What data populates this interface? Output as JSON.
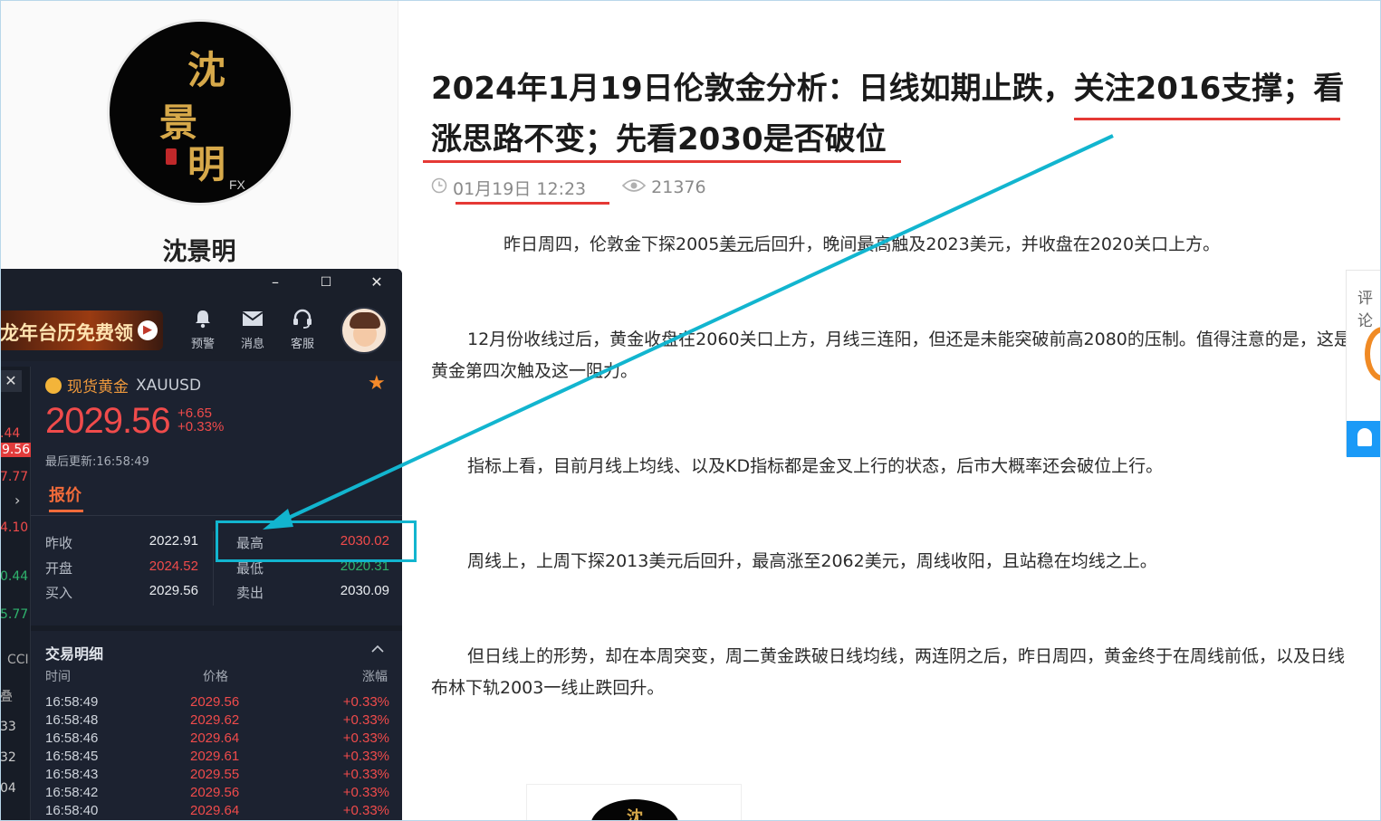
{
  "author": {
    "name": "沈景明",
    "logo_chars": [
      "沈",
      "景",
      "明"
    ],
    "logo_tag": "FX"
  },
  "article": {
    "title": "2024年1月19日伦敦金分析：日线如期止跌，关注2016支撑；看涨思路不变；先看2030是否破位",
    "date": "01月19日 12:23",
    "views": "21376",
    "paragraphs": [
      {
        "pre": "昨日周四，伦敦金下探2005",
        "link": "美元",
        "post": "后回升，晚间最高触及2023美元，并收盘在2020关口上方。"
      },
      {
        "pre": "12月份收线过后，黄金收盘在2060关口上方，月线三连阳，但还是未能突破前高2080的压制。值得注意的是，这是黄金第四次触及这一阻力。",
        "link": "",
        "post": ""
      },
      {
        "pre": "指标上看，目前月线上均线、以及KD指标都是金叉上行的状态，后市大概率还会破位上行。",
        "link": "",
        "post": ""
      },
      {
        "pre": "周线上，上周下探2013美元后回升，最高涨至2062美元，周线收阳，且站稳在均线之上。",
        "link": "",
        "post": ""
      },
      {
        "pre": "但日线上的形势，却在本周突变，周二黄金跌破日线均线，两连阴之后，昨日周四，黄金终于在周线前低，以及日线布林下轨2003一线止跌回升。",
        "link": "",
        "post": ""
      }
    ]
  },
  "side_widget": {
    "label": "评论"
  },
  "bottom_card": {
    "char": "沈"
  },
  "app": {
    "window_buttons": {
      "minimize": "–",
      "maximize": "☐",
      "close": "✕"
    },
    "banner_text": "龙年台历免费领",
    "tools": [
      {
        "icon": "bell-icon",
        "label": "预警"
      },
      {
        "icon": "mail-icon",
        "label": "消息"
      },
      {
        "icon": "headset-icon",
        "label": "客服"
      }
    ],
    "strip_values": [
      ".44",
      "9.56",
      "7.77",
      "4.10",
      "0.44",
      "5.77",
      "CCI",
      "叠",
      "33",
      "32",
      "04"
    ],
    "symbol": {
      "name_cn": "现货黄金",
      "code": "XAUUSD"
    },
    "price": "2029.56",
    "change": "+6.65",
    "change_pct": "+0.33%",
    "last_update": "最后更新:16:58:49",
    "tab": "报价",
    "quotes": [
      {
        "k1": "昨收",
        "v1": "2022.91",
        "k2": "最高",
        "v2": "2030.02"
      },
      {
        "k1": "开盘",
        "v1": "2024.52",
        "k2": "最低",
        "v2": "2020.31"
      },
      {
        "k1": "买入",
        "v1": "2029.56",
        "k2": "卖出",
        "v2": "2030.09"
      }
    ],
    "trades_title": "交易明细",
    "trades_headers": {
      "time": "时间",
      "price": "价格",
      "change": "涨幅"
    },
    "trades": [
      {
        "time": "16:58:49",
        "price": "2029.56",
        "change": "+0.33%"
      },
      {
        "time": "16:58:48",
        "price": "2029.62",
        "change": "+0.33%"
      },
      {
        "time": "16:58:46",
        "price": "2029.64",
        "change": "+0.33%"
      },
      {
        "time": "16:58:45",
        "price": "2029.61",
        "change": "+0.33%"
      },
      {
        "time": "16:58:43",
        "price": "2029.55",
        "change": "+0.33%"
      },
      {
        "time": "16:58:42",
        "price": "2029.56",
        "change": "+0.33%"
      },
      {
        "time": "16:58:40",
        "price": "2029.64",
        "change": "+0.33%"
      }
    ]
  },
  "colors": {
    "accent_red": "#e53935",
    "annotation_cyan": "#12b5cf",
    "price_red": "#f04b4b",
    "low_green": "#2fb36d"
  }
}
